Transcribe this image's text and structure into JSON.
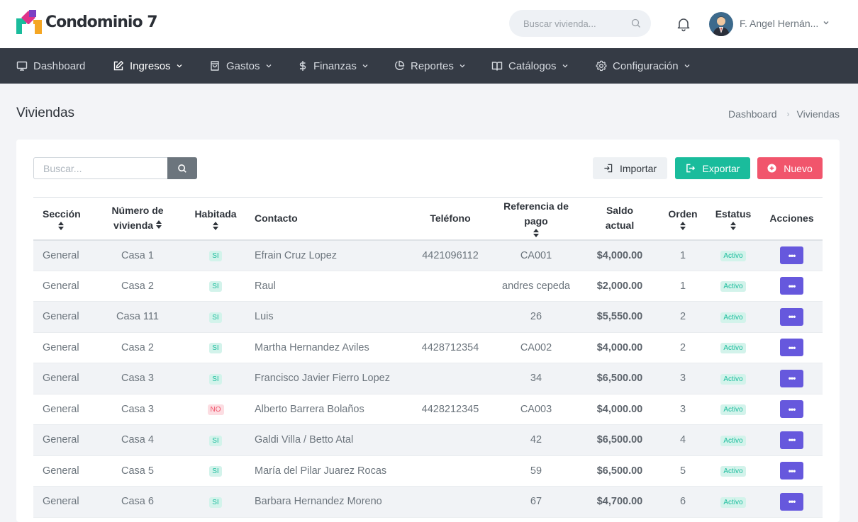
{
  "brand": {
    "name": "Condominio 7"
  },
  "header": {
    "search_placeholder": "Buscar vivienda...",
    "user_name": "F. Angel Hernán..."
  },
  "nav": {
    "items": [
      {
        "label": "Dashboard",
        "icon": "monitor-icon"
      },
      {
        "label": "Ingresos",
        "icon": "edit-icon"
      },
      {
        "label": "Gastos",
        "icon": "shopping-bag-icon"
      },
      {
        "label": "Finanzas",
        "icon": "dollar-icon"
      },
      {
        "label": "Reportes",
        "icon": "pie-chart-icon"
      },
      {
        "label": "Catálogos",
        "icon": "book-open-icon"
      },
      {
        "label": "Configuración",
        "icon": "gear-icon"
      }
    ]
  },
  "page": {
    "title": "Viviendas",
    "breadcrumb": [
      "Dashboard",
      "Viviendas"
    ]
  },
  "toolbar": {
    "search_placeholder": "Buscar...",
    "import_label": "Importar",
    "export_label": "Exportar",
    "new_label": "Nuevo"
  },
  "colors": {
    "accent": "#6658dd",
    "success": "#1abc9c",
    "danger": "#f1556c",
    "nav_bg": "#353b45"
  },
  "table": {
    "headers": {
      "seccion": "Sección",
      "numero_1": "Número de",
      "numero_2": "vivienda",
      "habitada": "Habitada",
      "contacto": "Contacto",
      "telefono": "Teléfono",
      "referencia": "Referencia de pago",
      "saldo_1": "Saldo",
      "saldo_2": "actual",
      "orden": "Orden",
      "estatus": "Estatus",
      "acciones": "Acciones"
    },
    "rows": [
      {
        "seccion": "General",
        "numero": "Casa 1",
        "habitada": "SI",
        "contacto": "Efrain Cruz Lopez",
        "telefono": "4421096112",
        "referencia": "CA001",
        "saldo": "$4,000.00",
        "orden": "1",
        "estatus": "Activo"
      },
      {
        "seccion": "General",
        "numero": "Casa 2",
        "habitada": "SI",
        "contacto": "Raul",
        "telefono": "",
        "referencia": "andres cepeda",
        "saldo": "$2,000.00",
        "orden": "1",
        "estatus": "Activo"
      },
      {
        "seccion": "General",
        "numero": "Casa 111",
        "habitada": "SI",
        "contacto": "Luis",
        "telefono": "",
        "referencia": "26",
        "saldo": "$5,550.00",
        "orden": "2",
        "estatus": "Activo"
      },
      {
        "seccion": "General",
        "numero": "Casa 2",
        "habitada": "SI",
        "contacto": "Martha Hernandez Aviles",
        "telefono": "4428712354",
        "referencia": "CA002",
        "saldo": "$4,000.00",
        "orden": "2",
        "estatus": "Activo"
      },
      {
        "seccion": "General",
        "numero": "Casa 3",
        "habitada": "SI",
        "contacto": "Francisco Javier Fierro Lopez",
        "telefono": "",
        "referencia": "34",
        "saldo": "$6,500.00",
        "orden": "3",
        "estatus": "Activo"
      },
      {
        "seccion": "General",
        "numero": "Casa 3",
        "habitada": "NO",
        "contacto": "Alberto Barrera Bolaños",
        "telefono": "4428212345",
        "referencia": "CA003",
        "saldo": "$4,000.00",
        "orden": "3",
        "estatus": "Activo"
      },
      {
        "seccion": "General",
        "numero": "Casa 4",
        "habitada": "SI",
        "contacto": "Galdi Villa / Betto Atal",
        "telefono": "",
        "referencia": "42",
        "saldo": "$6,500.00",
        "orden": "4",
        "estatus": "Activo"
      },
      {
        "seccion": "General",
        "numero": "Casa 5",
        "habitada": "SI",
        "contacto": "María del Pilar Juarez Rocas",
        "telefono": "",
        "referencia": "59",
        "saldo": "$6,500.00",
        "orden": "5",
        "estatus": "Activo"
      },
      {
        "seccion": "General",
        "numero": "Casa 6",
        "habitada": "SI",
        "contacto": "Barbara Hernandez Moreno",
        "telefono": "",
        "referencia": "67",
        "saldo": "$4,700.00",
        "orden": "6",
        "estatus": "Activo"
      }
    ],
    "action_glyph": "•••"
  }
}
